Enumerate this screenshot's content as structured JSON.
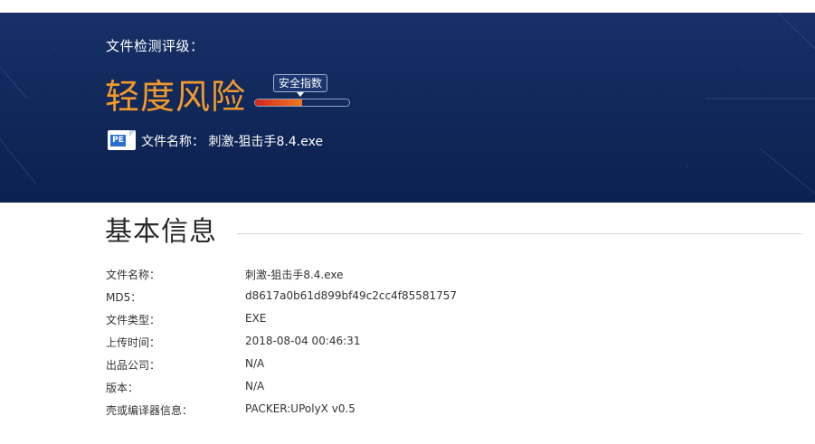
{
  "header": {
    "rating_label": "文件检测评级：",
    "risk_level": "轻度风险",
    "safety_index_label": "安全指数",
    "safety_index_fraction": 0.5,
    "file_icon_text": "PE",
    "file_caption": "文件名称： 刺激-狙击手8.4.exe"
  },
  "basic_info": {
    "title": "基本信息",
    "rows": [
      {
        "label": "文件名称：",
        "value": "刺激-狙击手8.4.exe"
      },
      {
        "label": "MD5：",
        "value": "d8617a0b61d899bf49c2cc4f85581757"
      },
      {
        "label": "文件类型：",
        "value": "EXE"
      },
      {
        "label": "上传时间：",
        "value": "2018-08-04 00:46:31"
      },
      {
        "label": "出品公司：",
        "value": "N/A"
      },
      {
        "label": "版本：",
        "value": "N/A"
      },
      {
        "label": "壳或编译器信息：",
        "value": "PACKER:UPolyX v0.5"
      }
    ]
  },
  "colors": {
    "banner": "#102759",
    "risk": "#f39a2a",
    "bar_fill_start": "#d3261e",
    "bar_fill_end": "#f07a22"
  }
}
